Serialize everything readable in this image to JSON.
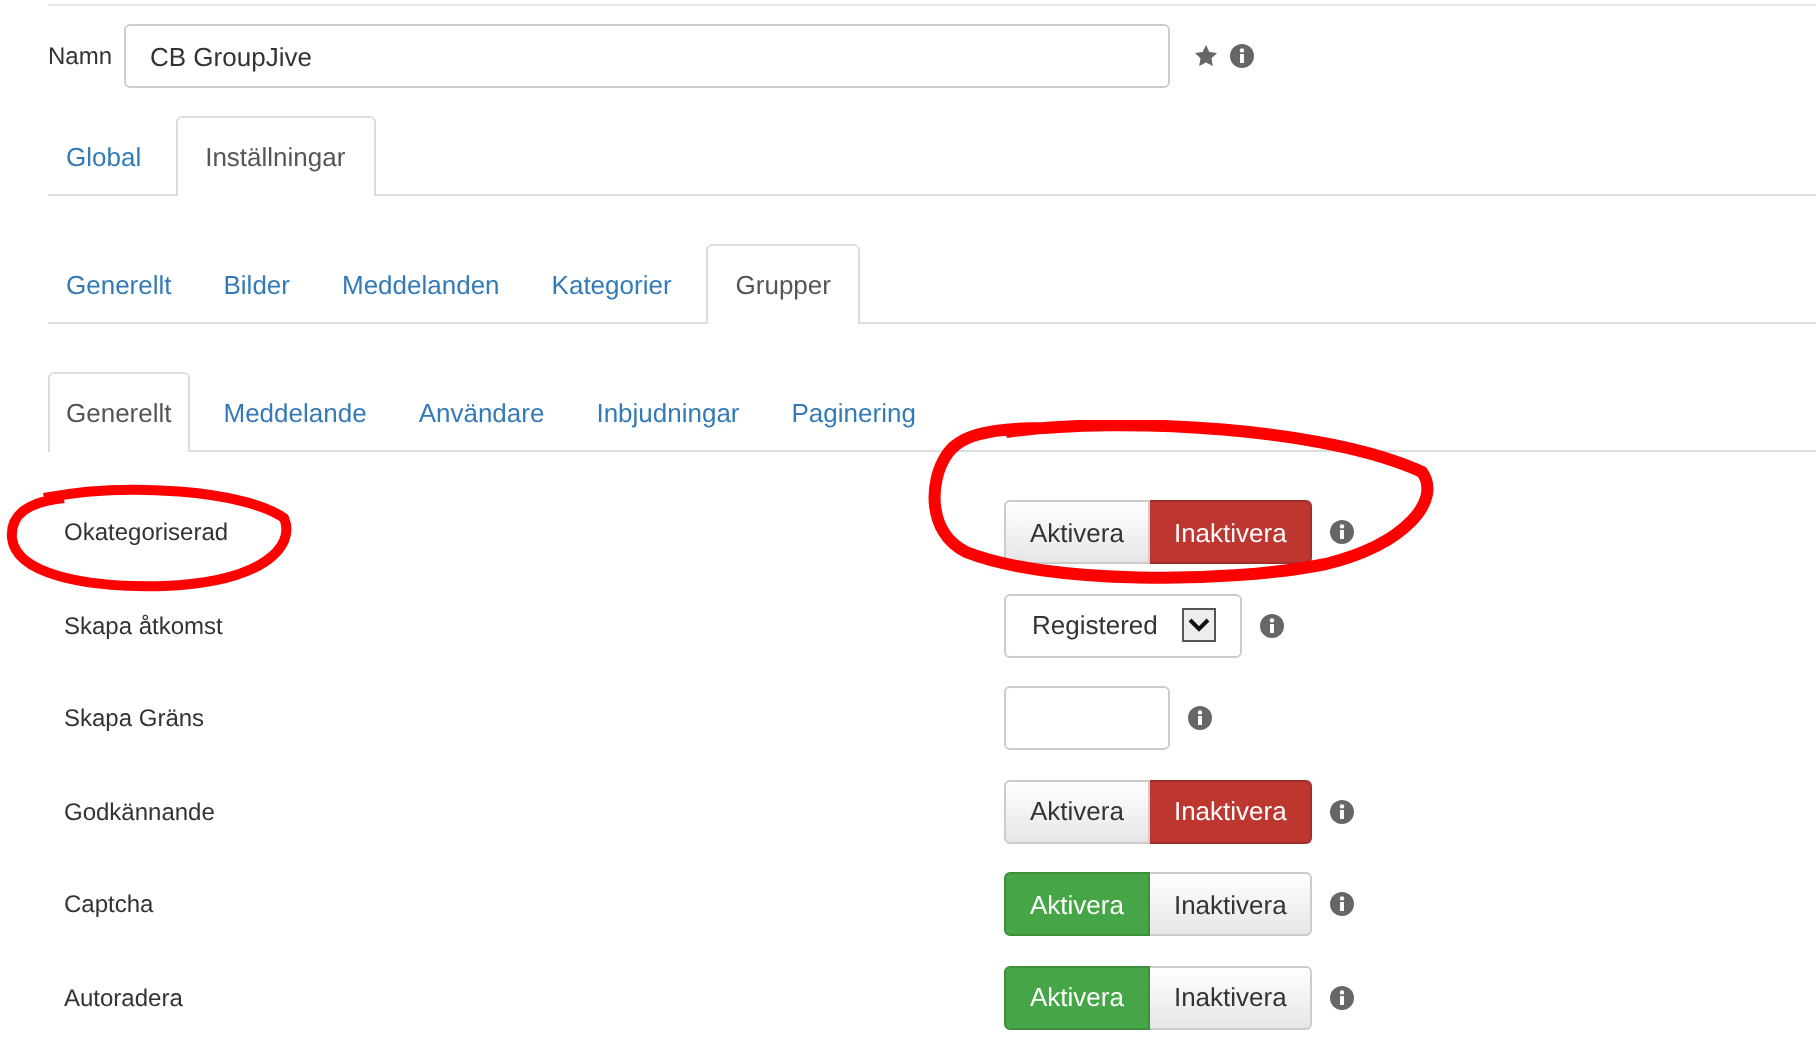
{
  "name_field": {
    "label": "Namn",
    "value": "CB GroupJive"
  },
  "tab_rows": [
    {
      "tabs": [
        {
          "label": "Global",
          "selected": false
        },
        {
          "label": "Inställningar",
          "selected": true
        }
      ]
    },
    {
      "tabs": [
        {
          "label": "Generellt",
          "selected": false
        },
        {
          "label": "Bilder",
          "selected": false
        },
        {
          "label": "Meddelanden",
          "selected": false
        },
        {
          "label": "Kategorier",
          "selected": false
        },
        {
          "label": "Grupper",
          "selected": true
        }
      ]
    },
    {
      "tabs": [
        {
          "label": "Generellt",
          "selected": true
        },
        {
          "label": "Meddelande",
          "selected": false
        },
        {
          "label": "Användare",
          "selected": false
        },
        {
          "label": "Inbjudningar",
          "selected": false
        },
        {
          "label": "Paginering",
          "selected": false
        }
      ]
    }
  ],
  "settings": [
    {
      "kind": "toggle",
      "label": "Okategoriserad",
      "circled": true,
      "options": [
        {
          "label": "Aktivera",
          "selected": false
        },
        {
          "label": "Inaktivera",
          "selected": true
        }
      ]
    },
    {
      "kind": "select",
      "label": "Skapa åtkomst",
      "circled": false,
      "value": "Registered"
    },
    {
      "kind": "input",
      "label": "Skapa Gräns",
      "circled": false
    },
    {
      "kind": "toggle",
      "label": "Godkännande",
      "circled": false,
      "options": [
        {
          "label": "Aktivera",
          "selected": false
        },
        {
          "label": "Inaktivera",
          "selected": true
        }
      ]
    },
    {
      "kind": "toggle",
      "label": "Captcha",
      "circled": false,
      "options": [
        {
          "label": "Aktivera",
          "selected": true
        },
        {
          "label": "Inaktivera",
          "selected": false
        }
      ]
    },
    {
      "kind": "toggle",
      "label": "Autoradera",
      "circled": false,
      "options": [
        {
          "label": "Aktivera",
          "selected": true
        },
        {
          "label": "Inaktivera",
          "selected": false
        }
      ]
    }
  ]
}
